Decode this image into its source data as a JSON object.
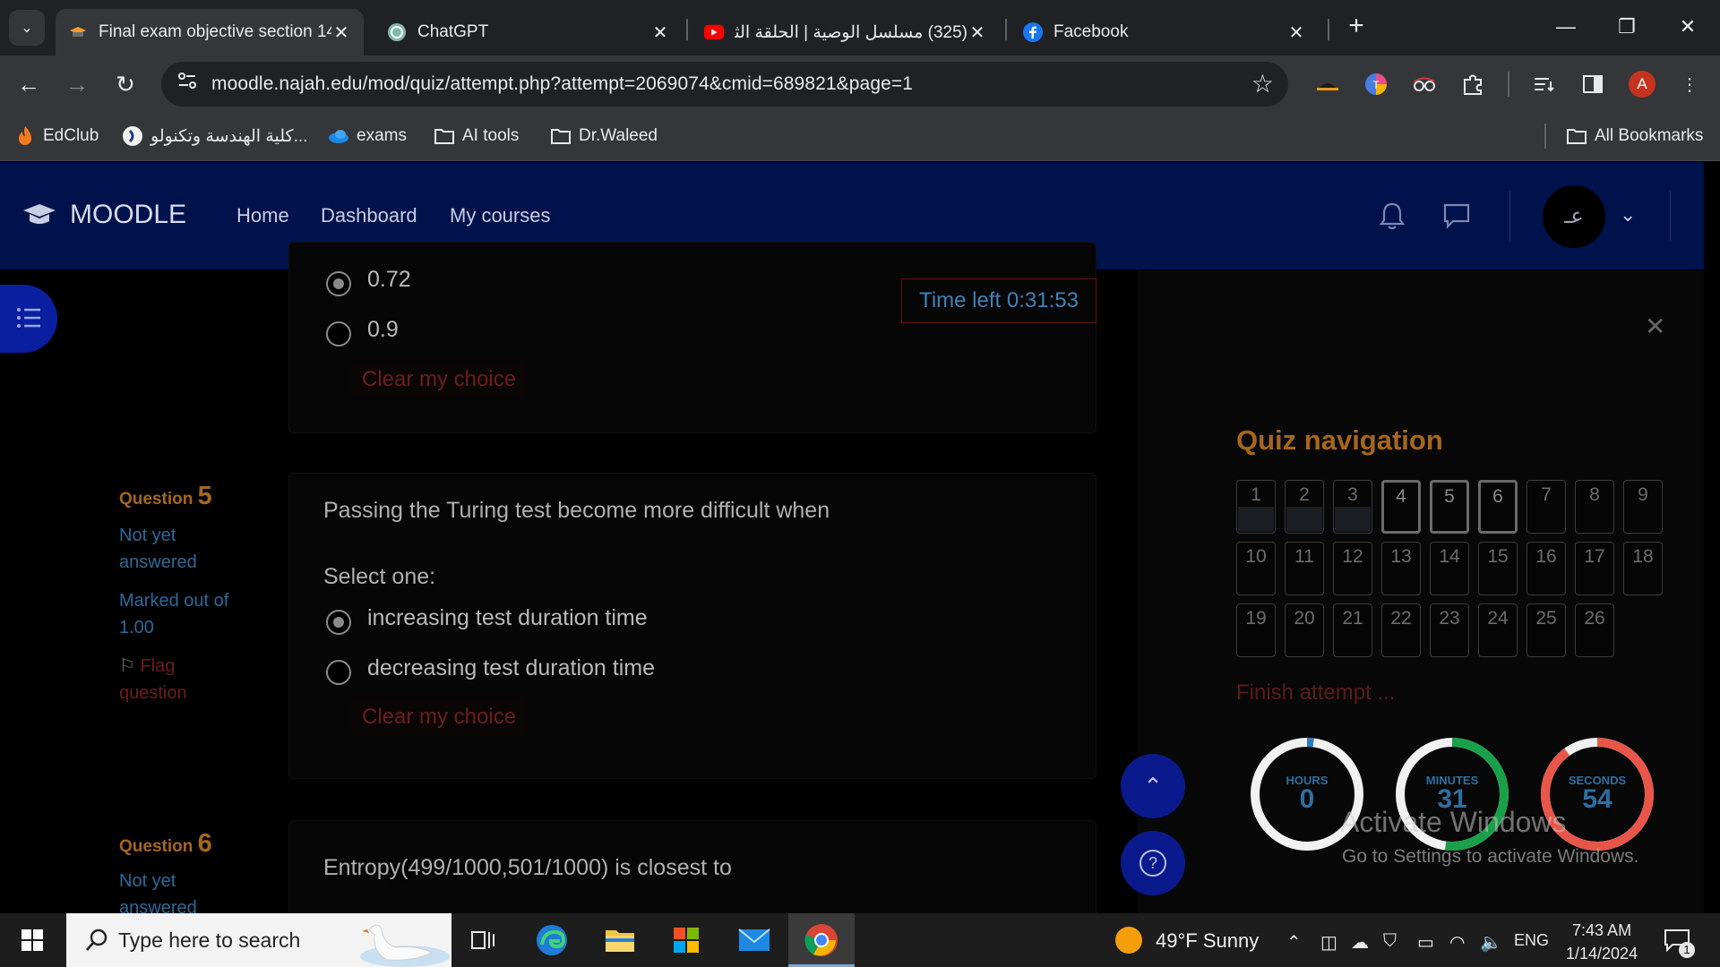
{
  "browser": {
    "tabs": [
      {
        "title": "Final exam objective section 14",
        "active": true
      },
      {
        "title": "ChatGPT",
        "active": false
      },
      {
        "title": "(325) مسلسل الوصية | الحلقة الثا",
        "active": false
      },
      {
        "title": "Facebook",
        "active": false
      }
    ],
    "url": "moodle.najah.edu/mod/quiz/attempt.php?attempt=2069074&cmid=689821&page=1",
    "bookmarks": [
      "EdClub",
      "كلية الهندسة وتكنولو...",
      "exams",
      "AI tools",
      "Dr.Waleed"
    ],
    "all_bookmarks": "All Bookmarks",
    "profile_initial": "A"
  },
  "moodle": {
    "brand": "MOODLE",
    "nav": [
      "Home",
      "Dashboard",
      "My courses"
    ],
    "user_initial": "عـ"
  },
  "quiz": {
    "timer": "Time left 0:31:53",
    "prev_options": [
      {
        "label": "0.72",
        "selected": true
      },
      {
        "label": "0.9",
        "selected": false
      }
    ],
    "clear_choice": "Clear my choice",
    "q5": {
      "label": "Question",
      "number": "5",
      "status": "Not yet answered",
      "status_line1": "Not yet",
      "status_line2": "answered",
      "marked_line1": "Marked out of",
      "marked_line2": "1.00",
      "flag_line1": "Flag",
      "flag_line2": "question",
      "text": "Passing the Turing test become more difficult when",
      "select_one": "Select one:",
      "options": [
        {
          "label": "increasing test duration time",
          "selected": true
        },
        {
          "label": "decreasing test duration time",
          "selected": false
        }
      ]
    },
    "q6": {
      "label": "Question",
      "number": "6",
      "status_line1": "Not yet",
      "status_line2": "answered",
      "text": "Entropy(499/1000,501/1000) is closest to"
    },
    "navigation": {
      "title": "Quiz navigation",
      "buttons": [
        "1",
        "2",
        "3",
        "4",
        "5",
        "6",
        "7",
        "8",
        "9",
        "10",
        "11",
        "12",
        "13",
        "14",
        "15",
        "16",
        "17",
        "18",
        "19",
        "20",
        "21",
        "22",
        "23",
        "24",
        "25",
        "26"
      ],
      "answered": [
        1,
        2,
        3
      ],
      "current": [
        4,
        5,
        6
      ],
      "finish": "Finish attempt ..."
    },
    "countdown": {
      "hours": {
        "label": "HOURS",
        "value": "0",
        "fraction": 0.02,
        "color": "#2a7fc0"
      },
      "minutes": {
        "label": "MINUTES",
        "value": "31",
        "fraction": 0.52,
        "color": "#1aa04a"
      },
      "seconds": {
        "label": "SECONDS",
        "value": "54",
        "fraction": 0.9,
        "color": "#e8564a"
      }
    }
  },
  "watermark": {
    "line1": "Activate Windows",
    "line2": "Go to Settings to activate Windows."
  },
  "taskbar": {
    "search_placeholder": "Type here to search",
    "weather": "49°F  Sunny",
    "language": "ENG",
    "time": "7:43 AM",
    "date": "1/14/2024",
    "notifications": "1"
  }
}
